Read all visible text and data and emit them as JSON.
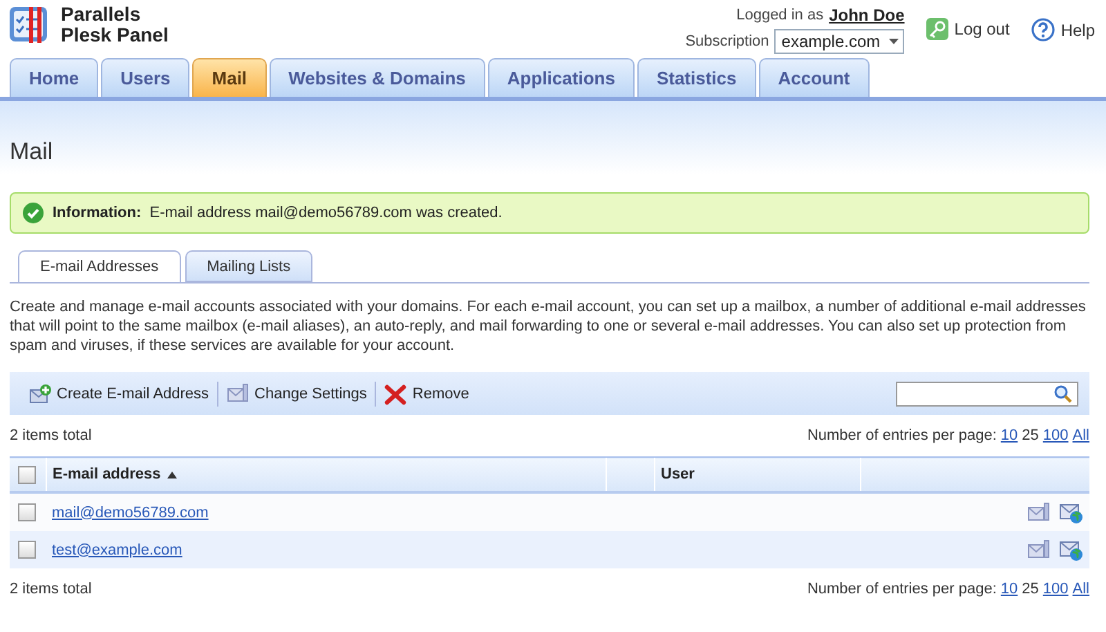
{
  "header": {
    "logo_lines": [
      "Parallels",
      "Plesk Panel"
    ],
    "logged_in_label": "Logged in as",
    "user_name": "John Doe",
    "subscription_label": "Subscription",
    "subscription_value": "example.com",
    "logout": "Log out",
    "help": "Help"
  },
  "nav_tabs": [
    {
      "label": "Home",
      "selected": false
    },
    {
      "label": "Users",
      "selected": false
    },
    {
      "label": "Mail",
      "selected": true
    },
    {
      "label": "Websites & Domains",
      "selected": false
    },
    {
      "label": "Applications",
      "selected": false
    },
    {
      "label": "Statistics",
      "selected": false
    },
    {
      "label": "Account",
      "selected": false
    }
  ],
  "page_title": "Mail",
  "message": {
    "title": "Information:",
    "text": "E-mail address mail@demo56789.com was created."
  },
  "sub_tabs": [
    {
      "label": "E-mail Addresses",
      "selected": true
    },
    {
      "label": "Mailing Lists",
      "selected": false
    }
  ],
  "description": "Create and manage e-mail accounts associated with your domains. For each e-mail account, you can set up a mailbox, a number of additional e-mail addresses that will point to the same mailbox (e-mail aliases), an auto-reply, and mail forwarding to one or several e-mail addresses. You can also set up protection from spam and viruses, if these services are available for your account.",
  "toolbar": [
    {
      "label": "Create E-mail Address",
      "kind": "create"
    },
    {
      "label": "Change Settings",
      "kind": "settings"
    },
    {
      "label": "Remove",
      "kind": "remove"
    }
  ],
  "list_top": {
    "total": "2 items total",
    "per_page_label": "Number of entries per page:",
    "per_page": [
      {
        "label": "10",
        "selected": false
      },
      {
        "label": "25",
        "selected": true
      },
      {
        "label": "100",
        "selected": false
      },
      {
        "label": "All",
        "selected": false
      }
    ]
  },
  "table": {
    "select_all_checked": false,
    "columns": [
      {
        "label": "E-mail address",
        "sorted_ascending": true
      },
      {
        "label": "User",
        "sorted_ascending": false
      }
    ],
    "rows": [
      {
        "email": "mail@demo56789.com",
        "checked": false
      },
      {
        "email": "test@example.com",
        "checked": false
      }
    ]
  },
  "list_bottom": {
    "total": "2 items total",
    "per_page_label": "Number of entries per page:",
    "per_page": [
      {
        "label": "10",
        "selected": false
      },
      {
        "label": "25",
        "selected": true
      },
      {
        "label": "100",
        "selected": false
      },
      {
        "label": "All",
        "selected": false
      }
    ]
  }
}
